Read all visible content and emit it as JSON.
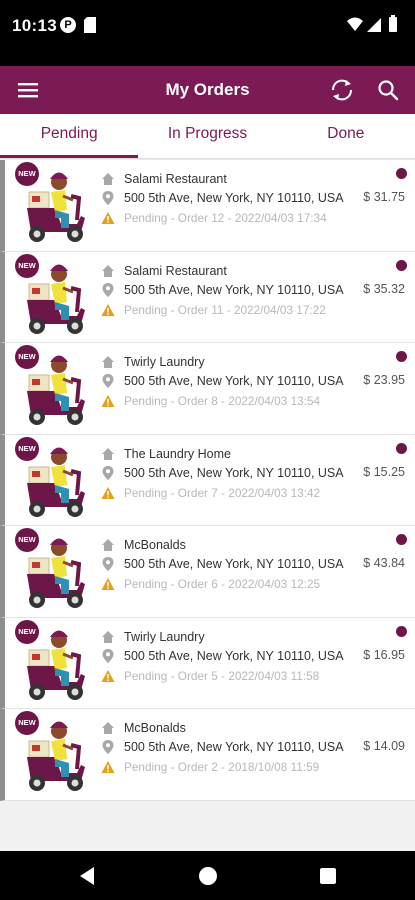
{
  "status_bar": {
    "time": "10:13",
    "app_icon_letter": "P"
  },
  "header": {
    "title": "My Orders",
    "menu_icon": "menu-icon",
    "refresh_icon": "refresh-icon",
    "search_icon": "search-icon"
  },
  "tabs": [
    {
      "label": "Pending",
      "active": true
    },
    {
      "label": "In Progress",
      "active": false
    },
    {
      "label": "Done",
      "active": false
    }
  ],
  "badge_label": "NEW",
  "orders": [
    {
      "shop": "Salami Restaurant",
      "address": "500 5th Ave, New York, NY 10110, USA",
      "status": "Pending - Order 12 - 2022/04/03 17:34",
      "price": "$ 31.75",
      "unread": true
    },
    {
      "shop": "Salami Restaurant",
      "address": "500 5th Ave, New York, NY 10110, USA",
      "status": "Pending - Order 11 - 2022/04/03 17:22",
      "price": "$ 35.32",
      "unread": true
    },
    {
      "shop": "Twirly Laundry",
      "address": "500 5th Ave, New York, NY 10110, USA",
      "status": "Pending - Order 8 - 2022/04/03 13:54",
      "price": "$ 23.95",
      "unread": true
    },
    {
      "shop": "The Laundry Home",
      "address": "500 5th Ave, New York, NY 10110, USA",
      "status": "Pending - Order 7 - 2022/04/03 13:42",
      "price": "$ 15.25",
      "unread": true
    },
    {
      "shop": "McBonalds",
      "address": "500 5th Ave, New York, NY 10110, USA",
      "status": "Pending - Order 6 - 2022/04/03 12:25",
      "price": "$ 43.84",
      "unread": true
    },
    {
      "shop": "Twirly Laundry",
      "address": "500 5th Ave, New York, NY 10110, USA",
      "status": "Pending - Order 5 - 2022/04/03 11:58",
      "price": "$ 16.95",
      "unread": true
    },
    {
      "shop": "McBonalds",
      "address": "500 5th Ave, New York, NY 10110, USA",
      "status": "Pending - Order 2 - 2018/10/08 11:59",
      "price": "$ 14.09",
      "unread": false
    }
  ],
  "colors": {
    "primary": "#7b1a55",
    "badge": "#6d1648",
    "warning": "#e0a21a",
    "muted": "#b8b8b8"
  }
}
